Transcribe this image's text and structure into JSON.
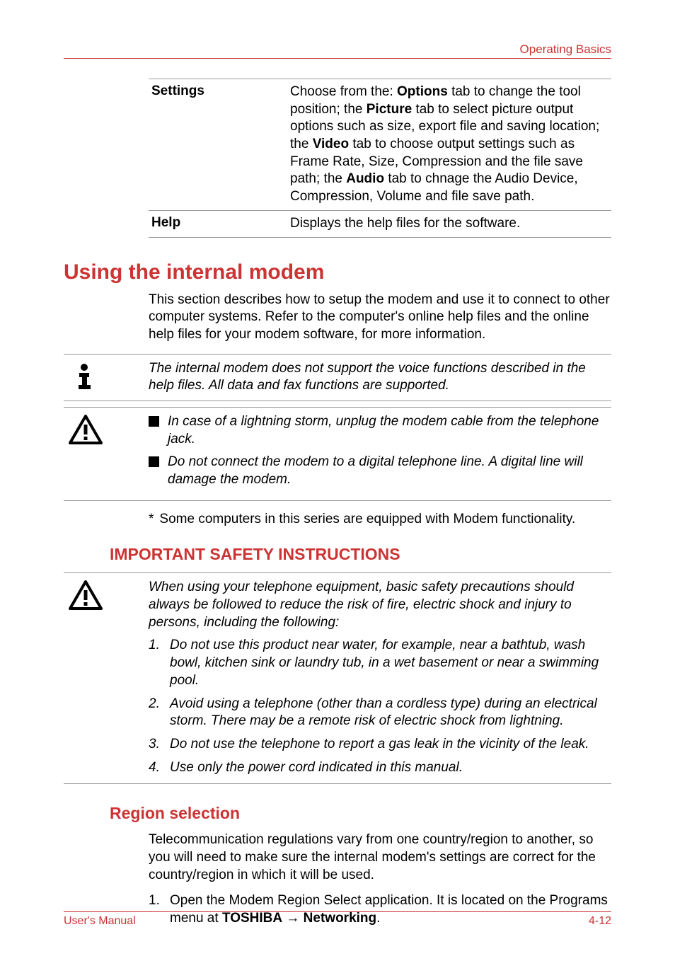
{
  "header": {
    "breadcrumb": "Operating Basics"
  },
  "settings_table": {
    "rows": [
      {
        "label": "Settings",
        "value_parts": {
          "p1": "Choose from the: ",
          "b1": "Options",
          "p2": " tab to change the tool position; the ",
          "b2": "Picture",
          "p3": " tab to select picture output options such as size, export file and saving location; the ",
          "b3": "Video",
          "p4": " tab to choose output settings such as Frame Rate, Size, Compression and the file save path; the ",
          "b4": "Audio",
          "p5": " tab to chnage the Audio Device, Compression, Volume and file save path."
        }
      },
      {
        "label": "Help",
        "value_plain": "Displays the help files for the software."
      }
    ]
  },
  "heading_modem": "Using the internal modem",
  "modem_intro": "This section describes how to setup the modem and use it to connect to other computer systems. Refer to the computer's online help files and the online help files for your modem software, for more information.",
  "note_modem": "The internal modem does not support the voice functions described in the help files. All data and fax functions are supported.",
  "warning_bullets": [
    "In case of a lightning storm, unplug the modem cable from the telephone jack.",
    "Do not connect the modem to a digital telephone line. A digital line will damage the modem."
  ],
  "footnote_star": "*",
  "footnote_text": "Some computers in this series are equipped with Modem functionality.",
  "heading_safety": "IMPORTANT SAFETY INSTRUCTIONS",
  "safety_intro": "When using your telephone equipment, basic safety precautions should always be followed to reduce the risk of fire, electric shock and injury to persons, including the following:",
  "safety_list": [
    "Do not use this product near water, for example, near a bathtub, wash bowl, kitchen sink or laundry tub, in a wet basement or near a swimming pool.",
    "Avoid using a telephone (other than a cordless type) during an electrical storm. There may be a remote risk of electric shock from lightning.",
    "Do not use the telephone to report a gas leak in the vicinity of the leak.",
    "Use only the power cord indicated in this manual."
  ],
  "heading_region": "Region selection",
  "region_intro": "Telecommunication regulations vary from one country/region to another, so you will need to make sure the internal modem's settings are correct for the country/region in which it will be used.",
  "region_step": {
    "pre": "Open the Modem Region Select application. It is located on the Programs menu at ",
    "b1": "TOSHIBA",
    "arrow": " → ",
    "b2": "Networking",
    "post": "."
  },
  "footer": {
    "left": "User's Manual",
    "right": "4-12"
  },
  "icons": {
    "info": "info-icon",
    "warning": "warning-icon"
  }
}
